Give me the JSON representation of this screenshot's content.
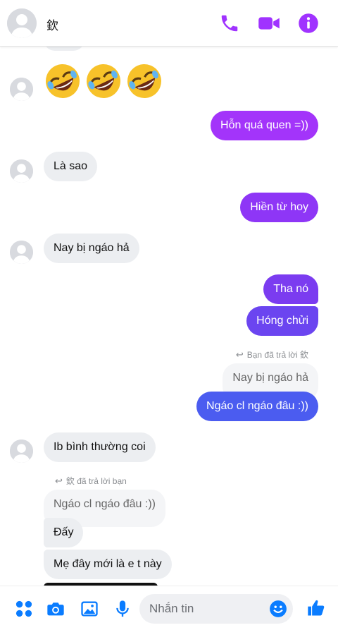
{
  "header": {
    "contact_name": "欽",
    "icons": [
      "phone-icon",
      "video-camera-icon",
      "info-icon"
    ],
    "accent_color": "#a033ff"
  },
  "messages": {
    "emoji_reaction": [
      "rolling-on-floor-laughing",
      "rolling-on-floor-laughing",
      "rolling-on-floor-laughing"
    ],
    "m1_out": "Hỗn quá quen =))",
    "m2_in": "Là sao",
    "m3_out": "Hiền từ hoy",
    "m4_in": "Nay bị ngáo hả",
    "m5_out": "Tha nó",
    "m6_out": "Hóng chửi",
    "reply_note_1": "Bạn đã trả lời 欽",
    "quoted_1": "Nay bị ngáo hả",
    "m7_out": "Ngáo cl ngáo đâu :))",
    "m8_in": "Ib bình thường coi",
    "reply_note_2": "欽 đã trả lời bạn",
    "quoted_2": "Ngáo cl ngáo đâu :))",
    "m9_in": "Đấy",
    "m10_in": "Mẹ đây mới là e t này"
  },
  "colors": {
    "bubble_purple": "#a334fa",
    "bubble_violet": "#7b3cf0",
    "bubble_indigo": "#5b4cf2",
    "bubble_blue": "#4b5cf0",
    "incoming_bg": "#eceef1",
    "icon_blue": "#0a7cff"
  },
  "composer": {
    "placeholder": "Nhắn tin",
    "icons": [
      "menu-dots-icon",
      "camera-icon",
      "image-icon",
      "microphone-icon",
      "emoji-icon",
      "thumbs-up-icon"
    ]
  }
}
